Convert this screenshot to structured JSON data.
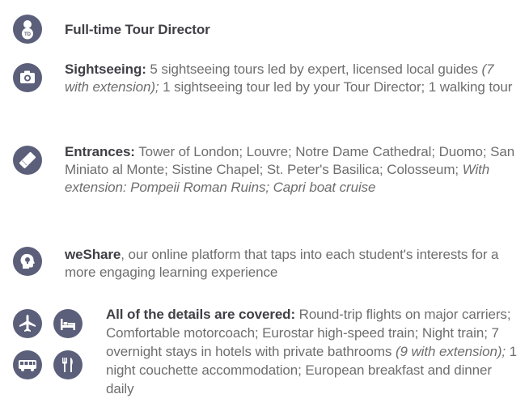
{
  "colors": {
    "icon_bg": "#5b5f7a",
    "heading": "#3f3f46",
    "body": "#6e6e6e"
  },
  "items": [
    {
      "icons": [
        "tour-director-icon"
      ],
      "td_badge": "TD",
      "lead": "Full-time Tour Director"
    },
    {
      "icons": [
        "camera-icon"
      ],
      "lead": "Sightseeing:",
      "text1": " 5 sightseeing tours led by expert, licensed local guides ",
      "italic1": "(7 with extension);",
      "text2": " 1 sightseeing tour led by your Tour Director; 1 walking tour"
    },
    {
      "icons": [
        "ticket-icon"
      ],
      "lead": "Entrances:",
      "text1": " Tower of London; Louvre; Notre Dame Cathedral; Duomo; San Miniato al Monte; Sistine Chapel; St. Peter's Basilica; Colosseum; ",
      "italic1": "With extension: Pompeii Roman Ruins; Capri boat cruise"
    },
    {
      "icons": [
        "head-lightbulb-icon"
      ],
      "lead": "weShare",
      "text1": ", our online platform that taps into each student's interests for a more engaging learning experience"
    },
    {
      "icons": [
        "airplane-icon",
        "bed-icon",
        "bus-icon",
        "restaurant-icon"
      ],
      "lead": "All of the details are covered:",
      "text1": " Round-trip flights on major carriers; Comfortable motorcoach; Eurostar high-speed train; Night train; 7 overnight stays in hotels with private bathrooms ",
      "italic1": "(9 with extension);",
      "text2": " 1 night couchette accommodation; European breakfast and dinner daily"
    }
  ]
}
